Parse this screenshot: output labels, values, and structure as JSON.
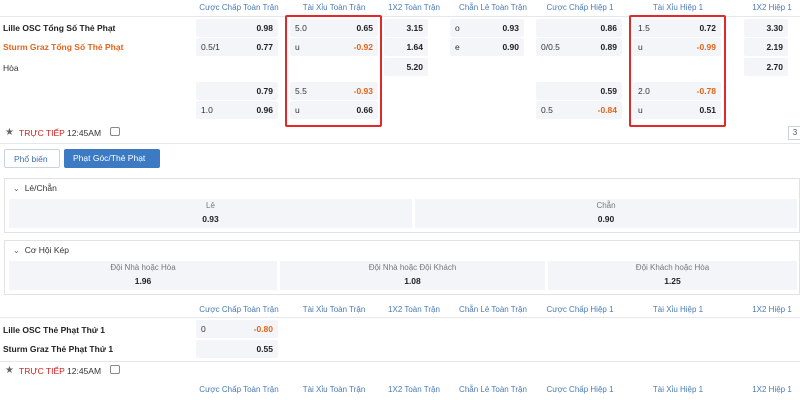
{
  "headers": {
    "hcp_ft": "Cược Chấp Toàn Trận",
    "ou_ft": "Tài Xỉu Toàn Trận",
    "x12_ft": "1X2 Toàn Trận",
    "oe_ft": "Chẵn Lẻ Toàn Trận",
    "hcp_h1": "Cược Chấp Hiệp 1",
    "ou_h1": "Tài Xỉu Hiệp 1",
    "x12_h1": "1X2 Hiệp 1"
  },
  "match1": {
    "home": "Lille OSC Tổng Số Thẻ Phạt",
    "away": "Sturm Graz Tổng Số Thẻ Phạt",
    "draw": "Hòa",
    "r1": {
      "hcp_r": "0.98",
      "ou_l": "5.0",
      "ou_r": "0.65",
      "x12": "3.15",
      "oe_l": "o",
      "oe_r": "0.93",
      "hcp1_r": "0.86",
      "ou1_l": "1.5",
      "ou1_r": "0.72",
      "x121": "3.30"
    },
    "r2": {
      "hcp_l": "0.5/1",
      "hcp_r": "0.77",
      "ou_l": "u",
      "ou_r": "-0.92",
      "x12": "1.64",
      "oe_l": "e",
      "oe_r": "0.90",
      "hcp1_l": "0/0.5",
      "hcp1_r": "0.89",
      "ou1_l": "u",
      "ou1_r": "-0.99",
      "x121": "2.19"
    },
    "r3": {
      "x12": "5.20",
      "x121": "2.70"
    },
    "r4": {
      "hcp_r": "0.79",
      "ou_l": "5.5",
      "ou_r": "-0.93",
      "hcp1_r": "0.59",
      "ou1_l": "2.0",
      "ou1_r": "-0.78"
    },
    "r5": {
      "hcp_l": "1.0",
      "hcp_r": "0.96",
      "ou_l": "u",
      "ou_r": "0.66",
      "hcp1_l": "0.5",
      "hcp1_r": "-0.84",
      "ou1_l": "u",
      "ou1_r": "0.51"
    }
  },
  "live": {
    "label": "TRỰC TIẾP",
    "time": "12:45AM"
  },
  "edge_button": "3",
  "tabs": {
    "popular": "Phổ biến",
    "corners": "Phạt Góc/Thẻ Phạt"
  },
  "odd_even": {
    "title": "Lẻ/Chẵn",
    "odd_label": "Lẻ",
    "odd_value": "0.93",
    "even_label": "Chẵn",
    "even_value": "0.90"
  },
  "double_chance": {
    "title": "Cơ Hội Kép",
    "o1_label": "Đội Nhà hoặc Hòa",
    "o1_value": "1.96",
    "o2_label": "Đội Nhà hoặc Đội Khách",
    "o2_value": "1.08",
    "o3_label": "Đội Khách hoặc Hòa",
    "o3_value": "1.25"
  },
  "match2": {
    "home": "Lille OSC Thẻ Phạt Thứ 1",
    "away": "Sturm Graz Thẻ Phạt Thứ 1",
    "r1": {
      "hcp_l": "0",
      "hcp_r": "-0.80"
    },
    "r2": {
      "hcp_r": "0.55"
    }
  },
  "colors": {
    "accent": "#3c7bc4",
    "negative": "#e0651a",
    "live": "#d32020",
    "highlight": "#e02a2a"
  }
}
